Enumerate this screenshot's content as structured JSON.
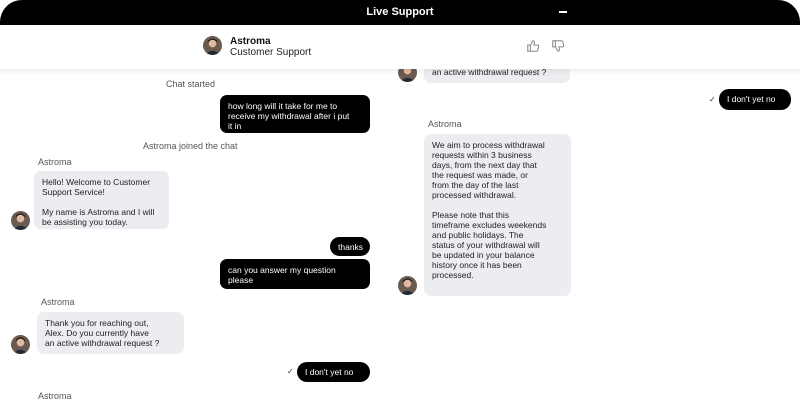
{
  "window": {
    "title": "Live Support"
  },
  "header": {
    "agent_name": "Astroma",
    "agent_role": "Customer Support"
  },
  "left_column": {
    "system_chat_started": "Chat started",
    "msg_user_1": "how long will it take for me to\nreceive my withdrawal after i put\nit in",
    "system_agent_joined": "Astroma joined the chat",
    "sender_1": "Astroma",
    "msg_agent_1": "Hello! Welcome to Customer\nSupport Service!\n\nMy name is Astroma and I will\nbe assisting you today.",
    "msg_user_2": "thanks",
    "msg_user_3": "can you answer my question\nplease",
    "sender_2": "Astroma",
    "msg_agent_2": "Thank you for reaching out,\nAlex. Do you currently have\nan active withdrawal request ?",
    "msg_user_4": "I don't yet no",
    "sender_3": "Astroma"
  },
  "right_column": {
    "msg_agent_partial": "an active withdrawal request ?",
    "msg_user_1": "I don't yet no",
    "sender_1": "Astroma",
    "msg_agent_1": "We aim to process withdrawal\nrequests within 3 business\ndays, from the next day that\nthe request was made, or\nfrom the day of the last\nprocessed withdrawal.\n\nPlease note that this\ntimeframe excludes weekends\nand public holidays. The\nstatus of your withdrawal will\nbe updated in your balance\nhistory once it has been\nprocessed."
  },
  "icons": {
    "check": "✓",
    "thumbs_up": "thumbs-up-icon",
    "thumbs_down": "thumbs-down-icon",
    "minimize": "minimize-icon"
  }
}
